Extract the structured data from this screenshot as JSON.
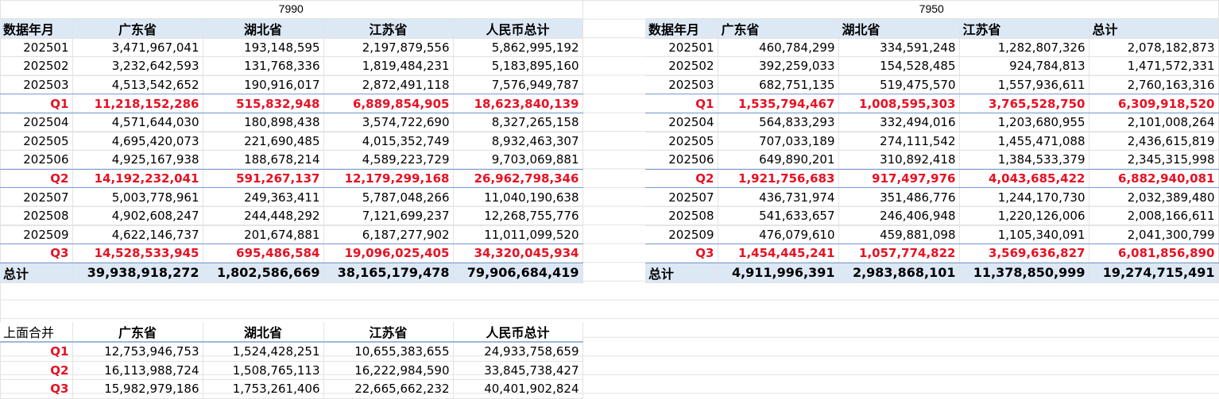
{
  "left": {
    "title": "7990",
    "header": [
      "数据年月",
      "广东省",
      "湖北省",
      "江苏省",
      "人民币总计"
    ],
    "rows": [
      {
        "label": "202501",
        "vals": [
          "3,471,967,041",
          "193,148,595",
          "2,197,879,556",
          "5,862,995,192"
        ]
      },
      {
        "label": "202502",
        "vals": [
          "3,232,642,593",
          "131,768,336",
          "1,819,484,231",
          "5,183,895,160"
        ]
      },
      {
        "label": "202503",
        "vals": [
          "4,513,542,652",
          "190,916,017",
          "2,872,491,118",
          "7,576,949,787"
        ]
      },
      {
        "label": "Q1",
        "vals": [
          "11,218,152,286",
          "515,832,948",
          "6,889,854,905",
          "18,623,840,139"
        ]
      },
      {
        "label": "202504",
        "vals": [
          "4,571,644,030",
          "180,898,438",
          "3,574,722,690",
          "8,327,265,158"
        ]
      },
      {
        "label": "202505",
        "vals": [
          "4,695,420,073",
          "221,690,485",
          "4,015,352,749",
          "8,932,463,307"
        ]
      },
      {
        "label": "202506",
        "vals": [
          "4,925,167,938",
          "188,678,214",
          "4,589,223,729",
          "9,703,069,881"
        ]
      },
      {
        "label": "Q2",
        "vals": [
          "14,192,232,041",
          "591,267,137",
          "12,179,299,168",
          "26,962,798,346"
        ]
      },
      {
        "label": "202507",
        "vals": [
          "5,003,778,961",
          "249,363,411",
          "5,787,048,266",
          "11,040,190,638"
        ]
      },
      {
        "label": "202508",
        "vals": [
          "4,902,608,247",
          "244,448,292",
          "7,121,699,237",
          "12,268,755,776"
        ]
      },
      {
        "label": "202509",
        "vals": [
          "4,622,146,737",
          "201,674,881",
          "6,187,277,902",
          "11,011,099,520"
        ]
      },
      {
        "label": "Q3",
        "vals": [
          "14,528,533,945",
          "695,486,584",
          "19,096,025,405",
          "34,320,045,934"
        ]
      }
    ],
    "total": {
      "label": "总计",
      "vals": [
        "39,938,918,272",
        "1,802,586,669",
        "38,165,179,478",
        "79,906,684,419"
      ]
    }
  },
  "right": {
    "title": "7950",
    "header": [
      "数据年月",
      "广东省",
      "湖北省",
      "江苏省",
      "总计"
    ],
    "rows": [
      {
        "label": "202501",
        "vals": [
          "460,784,299",
          "334,591,248",
          "1,282,807,326",
          "2,078,182,873"
        ]
      },
      {
        "label": "202502",
        "vals": [
          "392,259,033",
          "154,528,485",
          "924,784,813",
          "1,471,572,331"
        ]
      },
      {
        "label": "202503",
        "vals": [
          "682,751,135",
          "519,475,570",
          "1,557,936,611",
          "2,760,163,316"
        ]
      },
      {
        "label": "Q1",
        "vals": [
          "1,535,794,467",
          "1,008,595,303",
          "3,765,528,750",
          "6,309,918,520"
        ]
      },
      {
        "label": "202504",
        "vals": [
          "564,833,293",
          "332,494,016",
          "1,203,680,955",
          "2,101,008,264"
        ]
      },
      {
        "label": "202505",
        "vals": [
          "707,033,189",
          "274,111,542",
          "1,455,471,088",
          "2,436,615,819"
        ]
      },
      {
        "label": "202506",
        "vals": [
          "649,890,201",
          "310,892,418",
          "1,384,533,379",
          "2,345,315,998"
        ]
      },
      {
        "label": "Q2",
        "vals": [
          "1,921,756,683",
          "917,497,976",
          "4,043,685,422",
          "6,882,940,081"
        ]
      },
      {
        "label": "202507",
        "vals": [
          "436,731,974",
          "351,486,776",
          "1,244,170,730",
          "2,032,389,480"
        ]
      },
      {
        "label": "202508",
        "vals": [
          "541,633,657",
          "246,406,948",
          "1,220,126,006",
          "2,008,166,611"
        ]
      },
      {
        "label": "202509",
        "vals": [
          "476,079,610",
          "459,881,098",
          "1,105,340,091",
          "2,041,300,799"
        ]
      },
      {
        "label": "Q3",
        "vals": [
          "1,454,445,241",
          "1,057,774,822",
          "3,569,636,827",
          "6,081,856,890"
        ]
      }
    ],
    "total": {
      "label": "总计",
      "vals": [
        "4,911,996,391",
        "2,983,868,101",
        "11,378,850,999",
        "19,274,715,491"
      ]
    }
  },
  "merged": {
    "header": [
      "上面合并",
      "广东省",
      "湖北省",
      "江苏省",
      "人民币总计"
    ],
    "rows": [
      {
        "label": "Q1",
        "vals": [
          "12,753,946,753",
          "1,524,428,251",
          "10,655,383,655",
          "24,933,758,659"
        ]
      },
      {
        "label": "Q2",
        "vals": [
          "16,113,988,724",
          "1,508,765,113",
          "16,222,984,590",
          "33,845,738,427"
        ]
      },
      {
        "label": "Q3",
        "vals": [
          "15,982,979,186",
          "1,753,261,406",
          "22,665,662,232",
          "40,401,902,824"
        ]
      }
    ]
  },
  "colors": {
    "quarter_text": "#e81123",
    "header_bg": "#dde8f5",
    "grid": "#e3e3e3"
  }
}
